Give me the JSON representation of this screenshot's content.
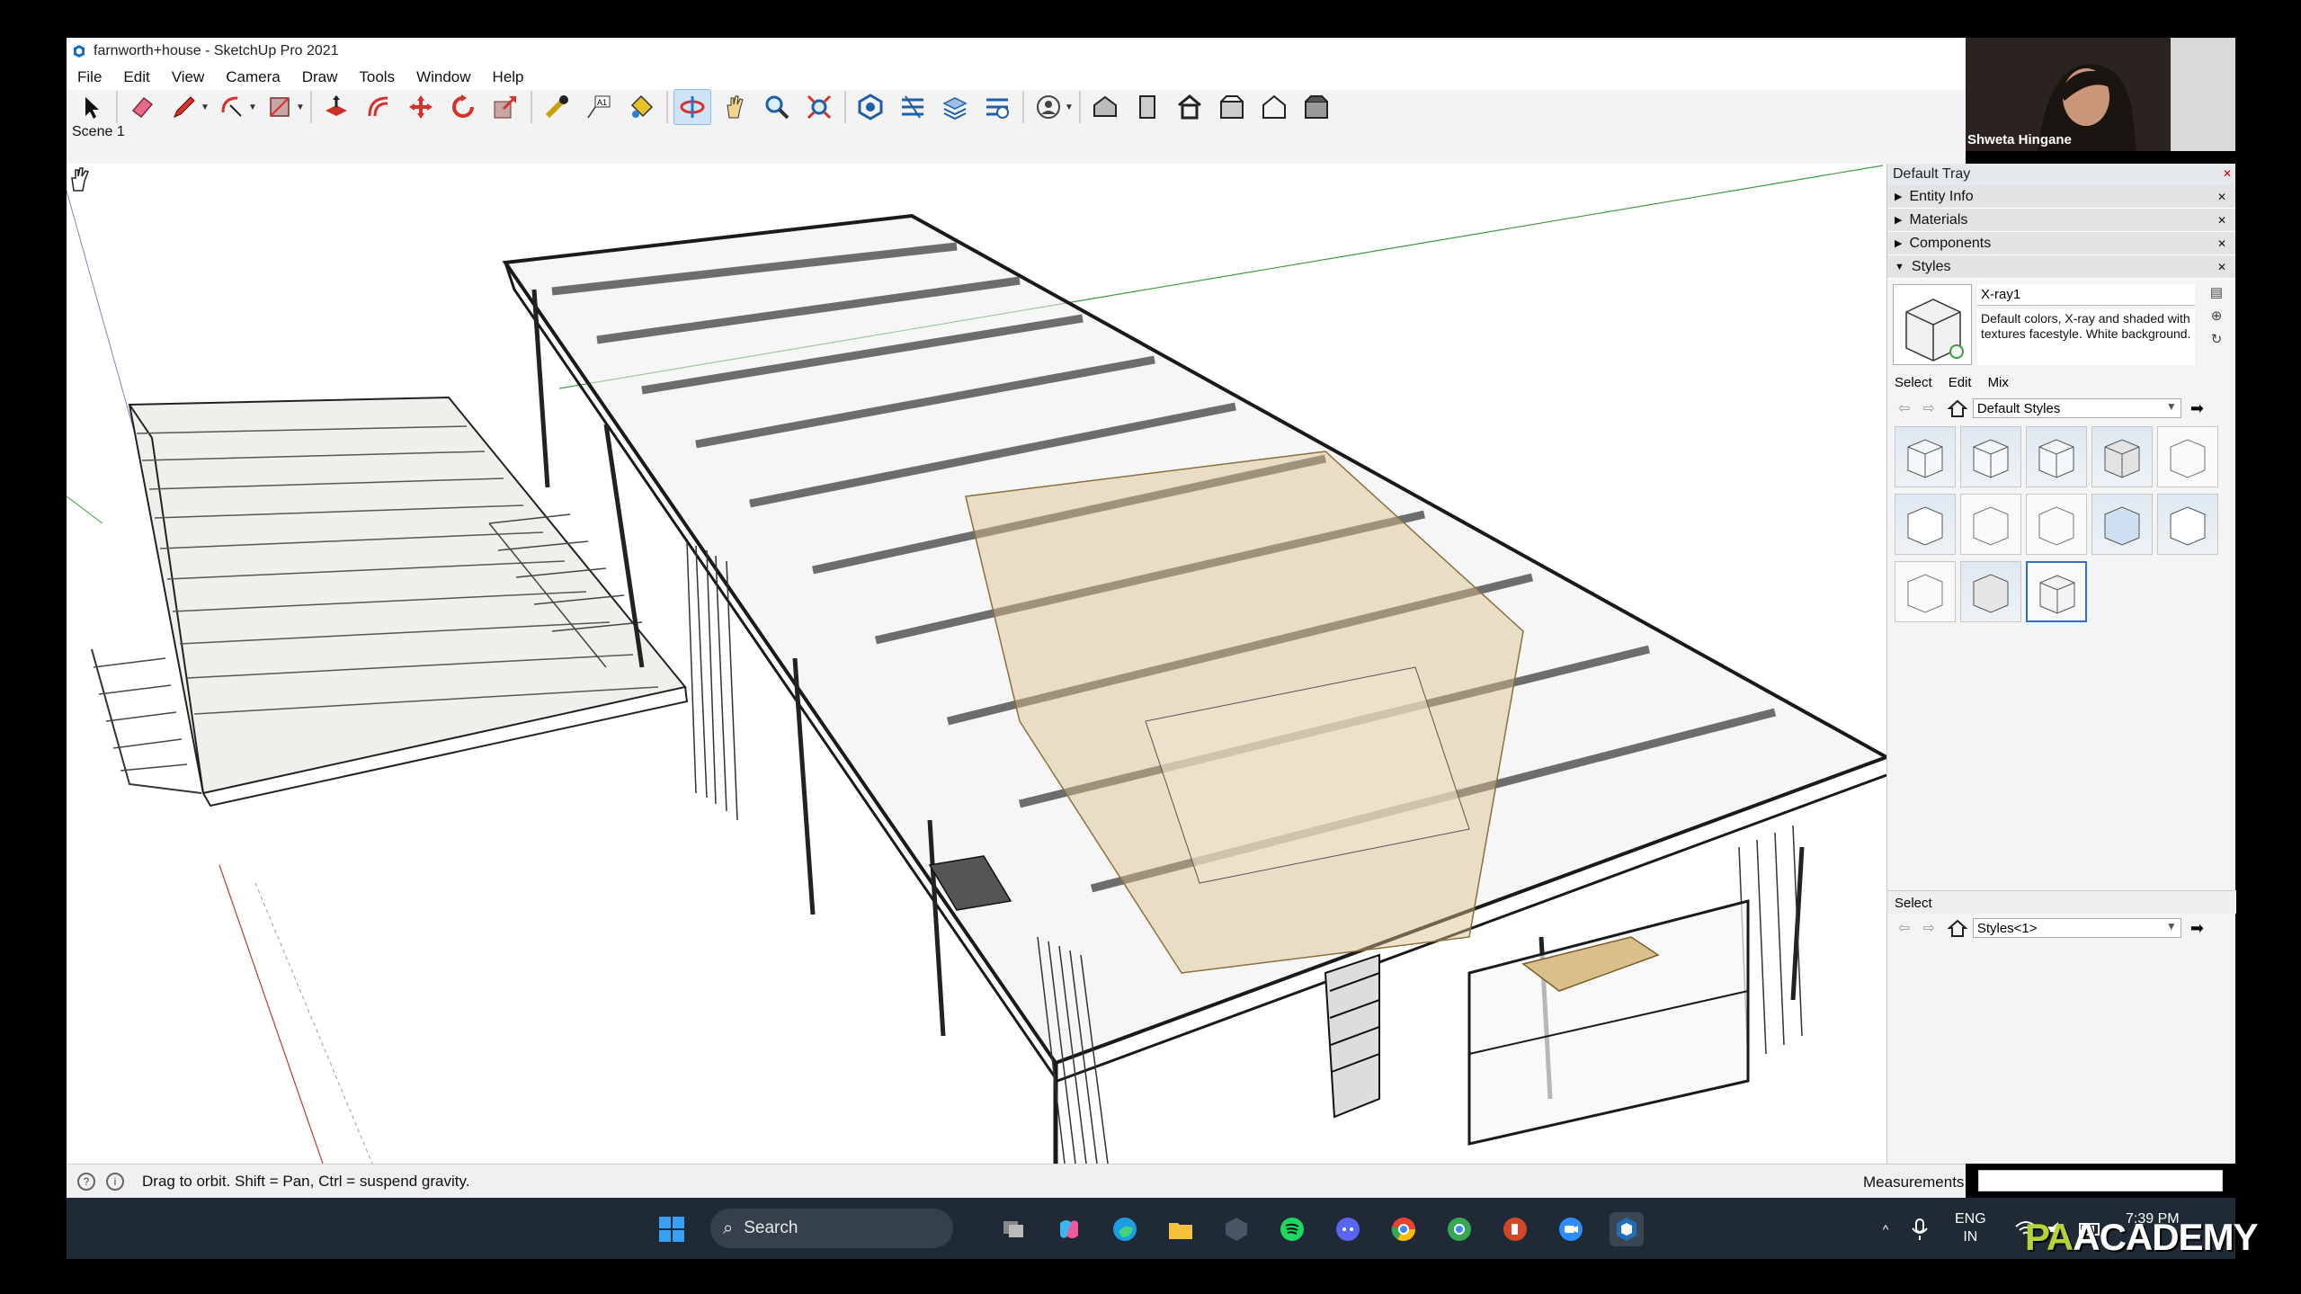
{
  "window": {
    "title": "farnworth+house - SketchUp Pro 2021"
  },
  "menu": [
    "File",
    "Edit",
    "View",
    "Camera",
    "Draw",
    "Tools",
    "Window",
    "Help"
  ],
  "toolbar": {
    "tools": [
      "select-tool",
      "eraser-tool",
      "line-tool",
      "arc-tool",
      "rectangle-tool",
      "push-pull-tool",
      "offset-tool",
      "move-tool",
      "rotate-tool",
      "scale-tool",
      "tape-measure-tool",
      "text-tool",
      "paint-bucket-tool",
      "orbit-tool",
      "pan-tool",
      "zoom-tool",
      "zoom-extents-tool",
      "warehouse-tool",
      "extension-warehouse-tool",
      "layout-tool",
      "extension-manager-tool",
      "user-account-tool",
      "iso-view",
      "front-view",
      "top-view",
      "right-view",
      "back-view",
      "left-view"
    ],
    "active_tool": "orbit-tool"
  },
  "scene": {
    "tab": "Scene 1"
  },
  "tray": {
    "title": "Default Tray",
    "panels": [
      {
        "label": "Entity Info",
        "expanded": false
      },
      {
        "label": "Materials",
        "expanded": false
      },
      {
        "label": "Components",
        "expanded": false
      },
      {
        "label": "Styles",
        "expanded": true
      }
    ],
    "style": {
      "name": "X-ray1",
      "description": "Default colors, X-ray and shaded with textures facestyle. White background."
    },
    "tabs": [
      "Select",
      "Edit",
      "Mix"
    ],
    "collection": "Default Styles",
    "second_select_label": "Select",
    "second_collection": "Styles<1>"
  },
  "status": {
    "hint": "Drag to orbit. Shift = Pan, Ctrl = suspend gravity.",
    "measurements_label": "Measurements"
  },
  "webcam": {
    "name": "Shweta Hingane"
  },
  "taskbar": {
    "search_placeholder": "Search",
    "language": [
      "ENG",
      "IN"
    ],
    "time": "7:39 PM"
  },
  "watermark": {
    "prefix": "PA",
    "suffix": "ACADEMY"
  },
  "colors": {
    "accent": "#2a6fd6",
    "taskbar": "#1f2a36",
    "tray_header": "#e3e3e3",
    "green_axis": "#3c9a3c",
    "red_axis": "#c0392b"
  }
}
